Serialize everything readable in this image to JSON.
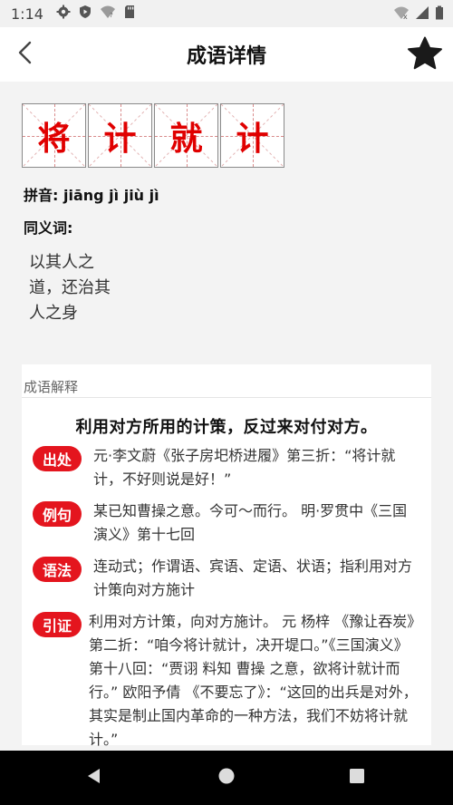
{
  "status_bar": {
    "time": "1:14",
    "icons_left": [
      "gear-icon",
      "shield-icon",
      "wifi-question-icon",
      "sd-card-icon"
    ],
    "icons_right": [
      "wifi-x-icon",
      "signal-icon",
      "battery-icon"
    ]
  },
  "app_bar": {
    "title": "成语详情",
    "back_icon": "chevron-left-icon",
    "favorite_icon": "star-icon"
  },
  "idiom": {
    "chars": [
      "将",
      "计",
      "就",
      "计"
    ],
    "pinyin_label": "拼音:",
    "pinyin": "jiāng jì jiù jì",
    "synonym_label": "同义词:",
    "synonym": "以其人之道，还治其人之身"
  },
  "explanation": {
    "header": "成语解释",
    "definition": "利用对方所用的计策，反过来对付对方。",
    "items": [
      {
        "badge": "出处",
        "text": "元·李文蔚《张子房圯桥进履》第三折：“将计就计，不好则说是好！”"
      },
      {
        "badge": "例句",
        "text": "某已知曹操之意。今可～而行。 明·罗贯中《三国演义》第十七回"
      },
      {
        "badge": "语法",
        "text": "连动式；作谓语、宾语、定语、状语；指利用对方计策向对方施计"
      },
      {
        "badge": "引证",
        "text": "利用对方计策，向对方施计。 元 杨梓 《豫让吞炭》第二折：“咱今将计就计，决开堤口。”《三国演义》第十八回：“贾诩 料知 曹操 之意，欲将计就计而行。” 欧阳予倩 《不要忘了》：“这回的出兵是对外，其实是制止国内革命的一种方法，我们不妨将计就计。”"
      }
    ]
  },
  "colors": {
    "accent_red": "#e4151e",
    "char_red": "#e00000",
    "background": "#f3f3f3"
  },
  "nav_bar": {
    "icons": [
      "back-triangle-icon",
      "home-circle-icon",
      "recents-square-icon"
    ]
  }
}
